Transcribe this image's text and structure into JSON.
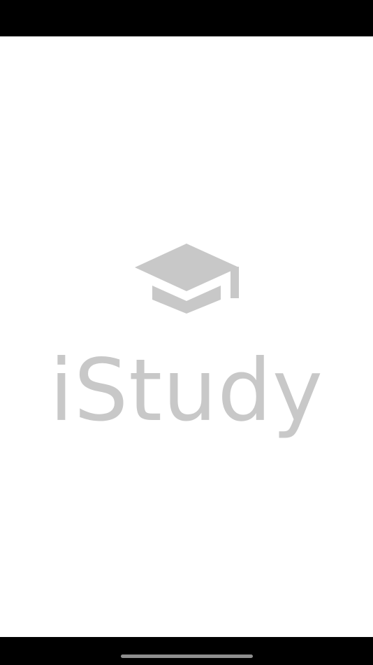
{
  "app": {
    "name": "iStudy",
    "logo_icon": "graduation-cap-icon"
  },
  "colors": {
    "background": "#ffffff",
    "logo": "#c8c8c8",
    "system_bars": "#000000",
    "home_indicator": "#8e8e8e"
  }
}
